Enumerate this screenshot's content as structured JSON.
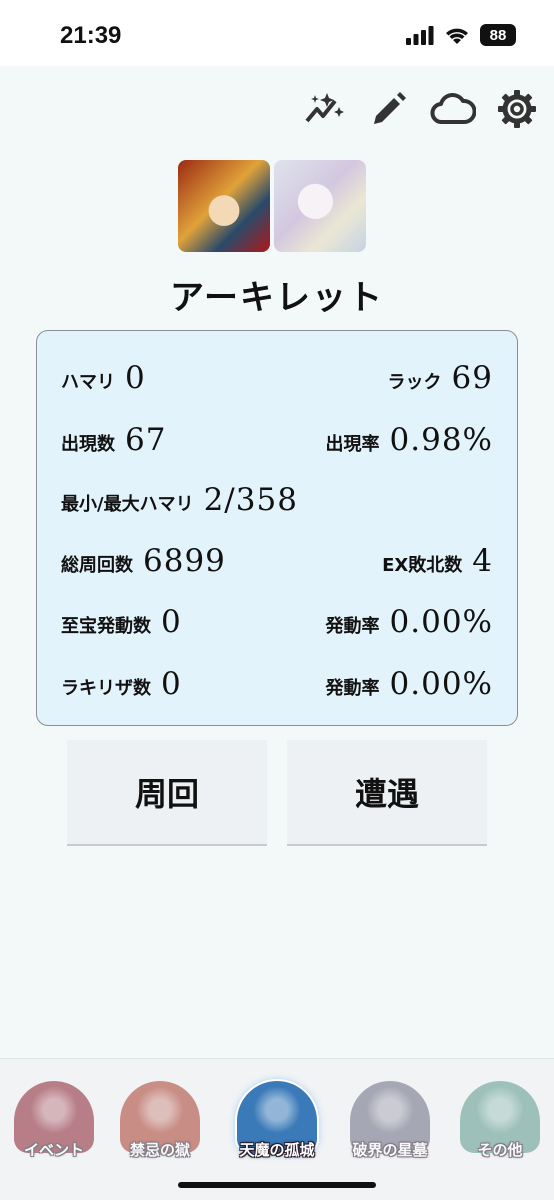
{
  "status_bar": {
    "time": "21:39",
    "battery": "88"
  },
  "toolbar": {
    "icons": [
      "sparkle-chart-icon",
      "pencil-icon",
      "cloud-icon",
      "gear-icon"
    ]
  },
  "character": {
    "name": "アーキレット"
  },
  "stats": {
    "hamari_label": "ハマリ",
    "hamari_value": "0",
    "luck_label": "ラック",
    "luck_value": "69",
    "appear_count_label": "出現数",
    "appear_count_value": "67",
    "appear_rate_label": "出現率",
    "appear_rate_value": "0.98%",
    "minmax_label": "最小/最大ハマリ",
    "minmax_value": "2/358",
    "total_laps_label": "総周回数",
    "total_laps_value": "6899",
    "ex_defeat_label": "EX敗北数",
    "ex_defeat_value": "4",
    "treasure_label": "至宝発動数",
    "treasure_value": "0",
    "treasure_rate_label": "発動率",
    "treasure_rate_value": "0.00%",
    "lucky_label": "ラキリザ数",
    "lucky_value": "0",
    "lucky_rate_label": "発動率",
    "lucky_rate_value": "0.00%"
  },
  "actions": {
    "lap": "周回",
    "encounter": "遭遇"
  },
  "bottom_nav": [
    {
      "label": "イベント",
      "color": "#8a2030",
      "active": false,
      "dim": true
    },
    {
      "label": "禁忌の獄",
      "color": "#a83a2a",
      "active": false,
      "dim": true
    },
    {
      "label": "天魔の孤城",
      "color": "#3a7ab8",
      "active": true,
      "dim": false
    },
    {
      "label": "破界の星墓",
      "color": "#6a6a80",
      "active": false,
      "dim": true
    },
    {
      "label": "その他",
      "color": "#5a9a8a",
      "active": false,
      "dim": true
    }
  ]
}
